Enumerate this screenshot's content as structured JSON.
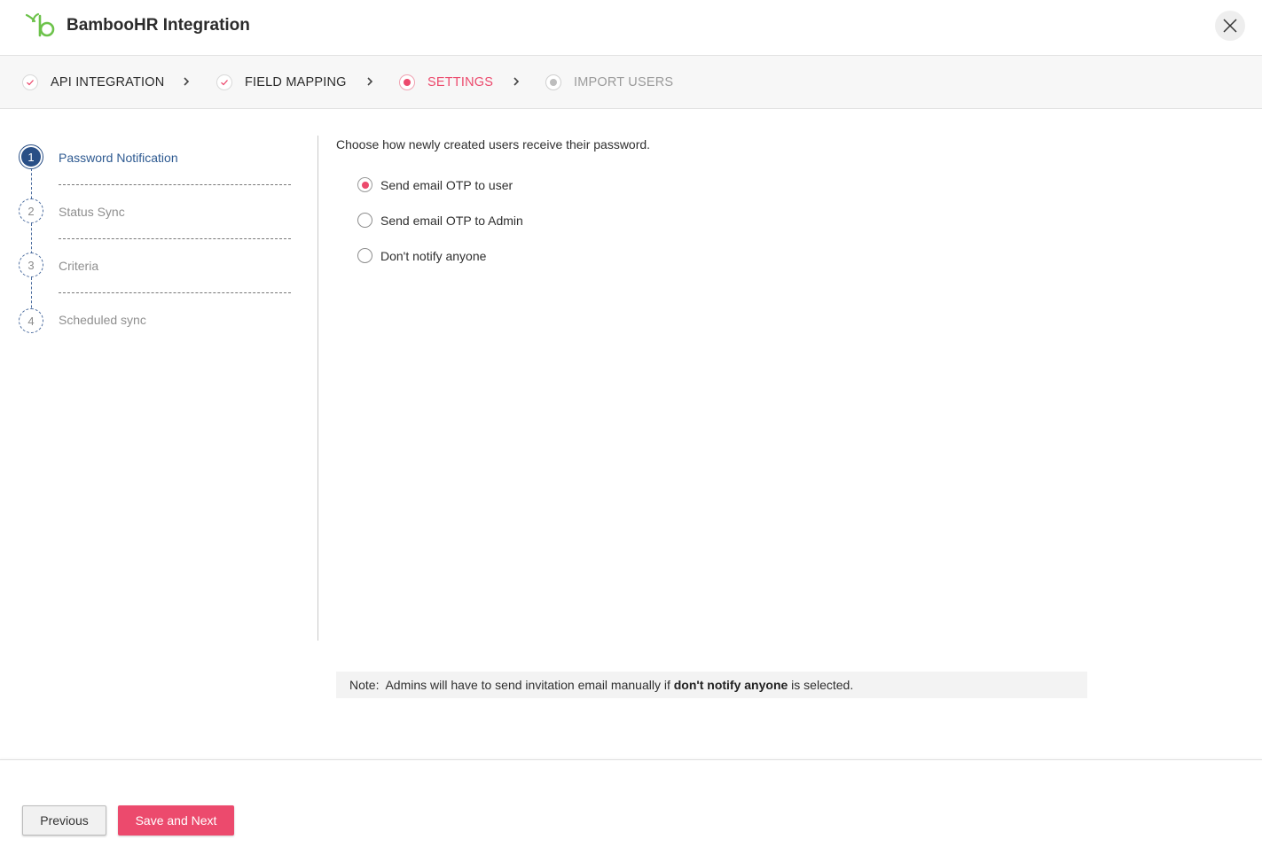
{
  "header": {
    "title": "BambooHR Integration",
    "logo_icon": "bamboohr-logo-icon",
    "close_icon": "close-icon"
  },
  "stepper": {
    "steps": [
      {
        "label": "API INTEGRATION",
        "state": "done"
      },
      {
        "label": "FIELD MAPPING",
        "state": "done"
      },
      {
        "label": "SETTINGS",
        "state": "active"
      },
      {
        "label": "IMPORT USERS",
        "state": "pending"
      }
    ]
  },
  "sidenav": {
    "items": [
      {
        "num": "1",
        "label": "Password Notification",
        "state": "active"
      },
      {
        "num": "2",
        "label": "Status Sync",
        "state": "pending"
      },
      {
        "num": "3",
        "label": "Criteria",
        "state": "pending"
      },
      {
        "num": "4",
        "label": "Scheduled sync",
        "state": "pending"
      }
    ]
  },
  "main": {
    "prompt": "Choose how newly created users receive their password.",
    "options": [
      {
        "label": "Send email OTP to user",
        "checked": true
      },
      {
        "label": "Send email OTP to Admin",
        "checked": false
      },
      {
        "label": "Don't notify anyone",
        "checked": false
      }
    ],
    "note": {
      "prefix": "Note:  Admins will have to send invitation email manually if ",
      "bold": "don't notify anyone",
      "suffix": " is selected."
    }
  },
  "footer": {
    "previous_label": "Previous",
    "next_label": "Save and Next"
  },
  "colors": {
    "accent": "#ec4a6d",
    "nav_active": "#294f86",
    "logo_green": "#6cc24a"
  }
}
